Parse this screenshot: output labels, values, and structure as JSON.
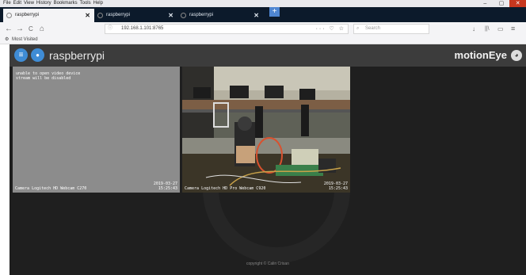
{
  "menu": [
    "File",
    "Edit",
    "View",
    "History",
    "Bookmarks",
    "Tools",
    "Help"
  ],
  "window_controls": [
    "–",
    "▢",
    "✕"
  ],
  "tabs": [
    {
      "label": "raspberrypi",
      "close": "✕",
      "active": true
    },
    {
      "label": "raspberrypi",
      "close": "✕",
      "active": false
    },
    {
      "label": "raspberrypi",
      "close": "✕",
      "active": false
    }
  ],
  "new_tab": "+",
  "nav": {
    "back": "←",
    "forward": "→",
    "reload": "C",
    "home": "⌂"
  },
  "url": {
    "lock": "ⓘ",
    "text": "192.168.1.101:8765",
    "tools": "··· ♡ ☆"
  },
  "search": {
    "icon": "⌕",
    "placeholder": "Search"
  },
  "toolbar_right": [
    "↓",
    "||\\",
    "▭",
    "≡"
  ],
  "bookmarks": {
    "icon": "⚙",
    "label": "Most Visited"
  },
  "app": {
    "title": "raspberrypi",
    "brand": "motionEye",
    "menu_icon": "≡",
    "user_icon": "●",
    "brand_icon": "◕"
  },
  "cameras": [
    {
      "error": "unable to open video device\nstream will be disabled",
      "left_overlay": "Camera Logitech HD Webcam C270",
      "right_overlay": "2019-03-27\n15:25:43"
    },
    {
      "left_overlay": "Camera Logitech HD Pro Webcam C920",
      "right_overlay": "2019-03-27\n15:25:43"
    }
  ],
  "footer": "copyright © Calin Crisan",
  "colors": {
    "tabbar": "#0c1a2b",
    "header": "#3c3c3c",
    "accent": "#3f8cd5",
    "page_bg": "#1f1f1f"
  }
}
